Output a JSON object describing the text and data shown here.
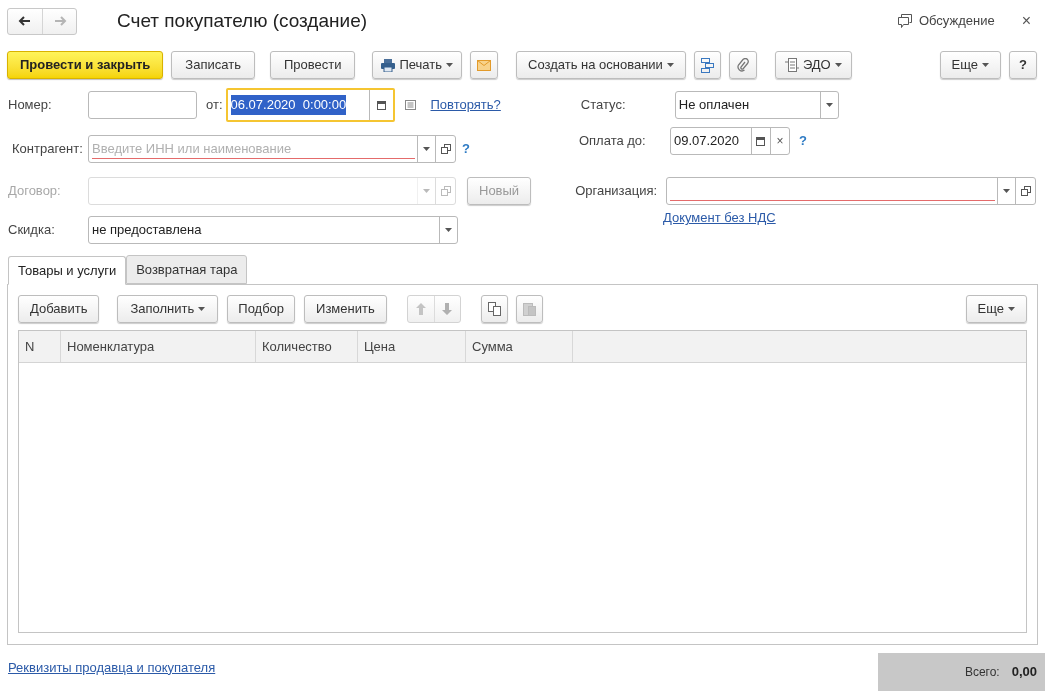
{
  "window": {
    "title": "Счет покупателю (создание)",
    "discussion": "Обсуждение",
    "close": "×"
  },
  "navigation": [
    {
      "kind": "back",
      "disabled": false
    },
    {
      "kind": "forward",
      "disabled": true
    }
  ],
  "toolbar": {
    "post_and_close": "Провести и закрыть",
    "save": "Записать",
    "post": "Провести",
    "print": "Печать",
    "create_based_on": "Создать на основании",
    "edo": "ЭДО",
    "more": "Еще",
    "help": "?"
  },
  "number": {
    "label": "Номер:"
  },
  "date": {
    "label": "от:",
    "value": "06.07.2020  0:00:00",
    "focused": true
  },
  "repeat_link": "Повторять?",
  "status": {
    "label": "Статус:",
    "value": "Не оплачен"
  },
  "counterparty": {
    "label": "Контрагент:",
    "placeholder": "Введите ИНН или наименование",
    "invalid": true,
    "help": "?"
  },
  "pay_until": {
    "label": "Оплата до:",
    "value": "09.07.2020",
    "clear": "×",
    "help": "?"
  },
  "contract": {
    "label": "Договор:",
    "disabled": true,
    "new_button": "Новый"
  },
  "organization": {
    "label": "Организация:",
    "invalid": true
  },
  "discount": {
    "label": "Скидка:",
    "value": "не предоставлена"
  },
  "vat_link": "Документ без НДС",
  "tabs": [
    {
      "label": "Товары и услуги",
      "selected": true
    },
    {
      "label": "Возвратная тара",
      "selected": false
    }
  ],
  "table_toolbar": {
    "add": "Добавить",
    "fill": "Заполнить",
    "pick": "Подбор",
    "edit": "Изменить",
    "more": "Еще"
  },
  "table": {
    "columns": [
      "N",
      "Номенклатура",
      "Количество",
      "Цена",
      "Сумма"
    ]
  },
  "footer": {
    "link": "Реквизиты продавца и покупателя",
    "total_label": "Всего:",
    "total": "0,00"
  }
}
